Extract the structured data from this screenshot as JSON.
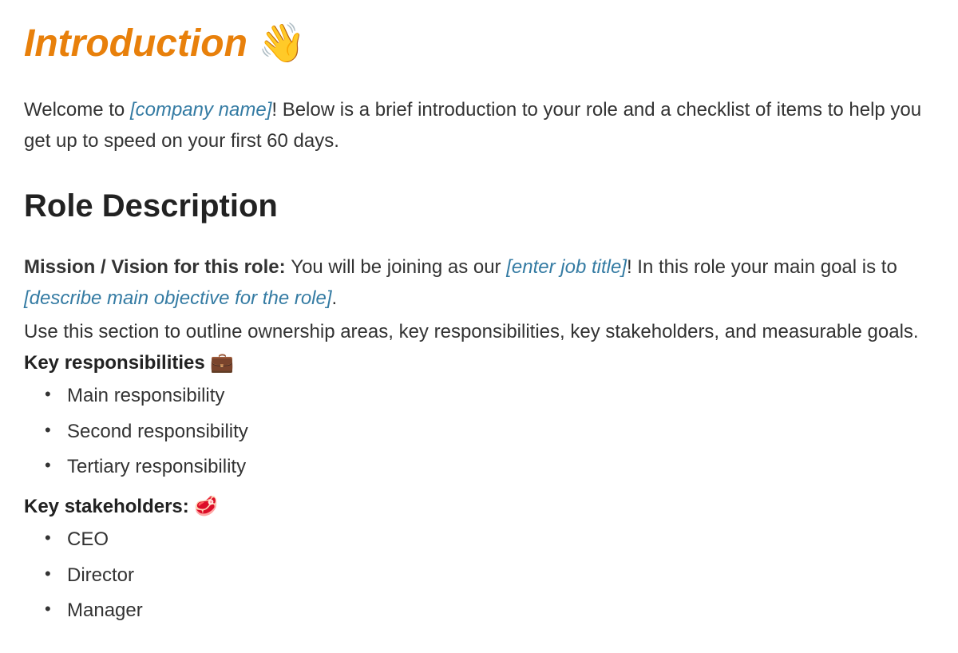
{
  "title": {
    "text": "Introduction",
    "emoji": "👋"
  },
  "intro": {
    "prefix": "Welcome to ",
    "placeholder": "[company name]",
    "suffix": "! Below is a brief introduction to your role and a checklist of items to help you get up to speed on your first 60 days."
  },
  "role_heading": "Role Description",
  "mission": {
    "label": "Mission / Vision for this role: ",
    "text1": "You will be joining as our ",
    "placeholder1": "[enter job title]",
    "text2": "! In this role your main goal is to ",
    "placeholder2": "[describe main objective for the role]",
    "text3": "."
  },
  "section_note": "Use this section to outline ownership areas, key responsibilities, key stakeholders, and measurable goals.",
  "responsibilities": {
    "heading": "Key responsibilities 💼",
    "items": [
      "Main responsibility",
      "Second responsibility",
      "Tertiary responsibility"
    ]
  },
  "stakeholders": {
    "heading": "Key stakeholders: 🥩",
    "items": [
      "CEO",
      "Director",
      "Manager"
    ]
  }
}
